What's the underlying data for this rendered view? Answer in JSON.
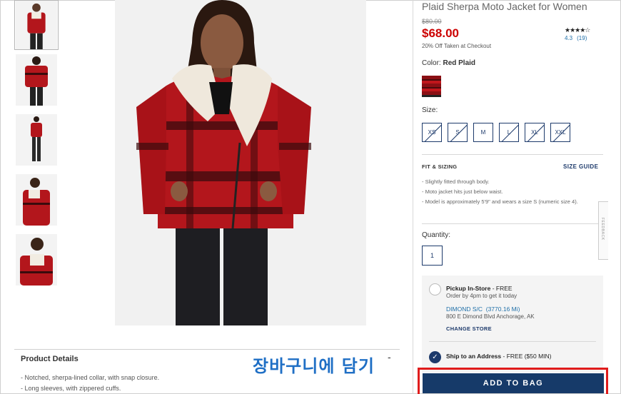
{
  "product": {
    "title": "Plaid Sherpa Moto Jacket for Women",
    "original_price": "$80.00",
    "sale_price": "$68.00",
    "discount_note": "20% Off Taken at Checkout",
    "stars": "★★★★☆",
    "rating_value": "4.3",
    "review_count": "(19)"
  },
  "color": {
    "label": "Color:",
    "value": "Red Plaid",
    "swatch_color": "#a3141a"
  },
  "size": {
    "label": "Size:",
    "options": [
      {
        "label": "XS",
        "available": false
      },
      {
        "label": "S",
        "available": false
      },
      {
        "label": "M",
        "available": true
      },
      {
        "label": "L",
        "available": false
      },
      {
        "label": "XL",
        "available": false
      },
      {
        "label": "XXL",
        "available": false
      }
    ]
  },
  "fit": {
    "title": "FIT & SIZING",
    "size_guide_link": "SIZE GUIDE",
    "items": [
      "Slightly fitted through body.",
      "Moto jacket hits just below waist.",
      "Model is approximately 5'9\" and wears a size S (numeric size 4)."
    ]
  },
  "feedback_tab": "FEEDBACK",
  "quantity": {
    "label": "Quantity:",
    "value": "1"
  },
  "fulfillment": {
    "pickup_title": "Pickup In-Store",
    "pickup_price": " - FREE",
    "pickup_note": "Order by 4pm to get it today",
    "store_name": "DIMOND S/C",
    "store_distance": "(3770.16 Mi)",
    "store_address": "800 E Dimond Blvd Anchorage, AK",
    "change_store": "CHANGE STORE",
    "ship_title": "Ship to an Address",
    "ship_price": " - FREE ($50 MIN)",
    "ship_selected": true
  },
  "add_to_bag": "ADD TO BAG",
  "details": {
    "title": "Product Details",
    "items": [
      "Notched, sherpa-lined collar, with snap closure.",
      "Long sleeves, with zippered cuffs."
    ]
  },
  "annotation": {
    "text": "장바구니에 담기",
    "mark": "-",
    "color": "#1f6fc5",
    "highlight_color": "#e01c1c"
  },
  "thumbnails": [
    "front-view",
    "back-view",
    "full-length-view",
    "side-view",
    "detail-view"
  ],
  "colors": {
    "brand_navy": "#163a69",
    "price_red": "#cc0000",
    "link_blue": "#1f6fa8"
  }
}
